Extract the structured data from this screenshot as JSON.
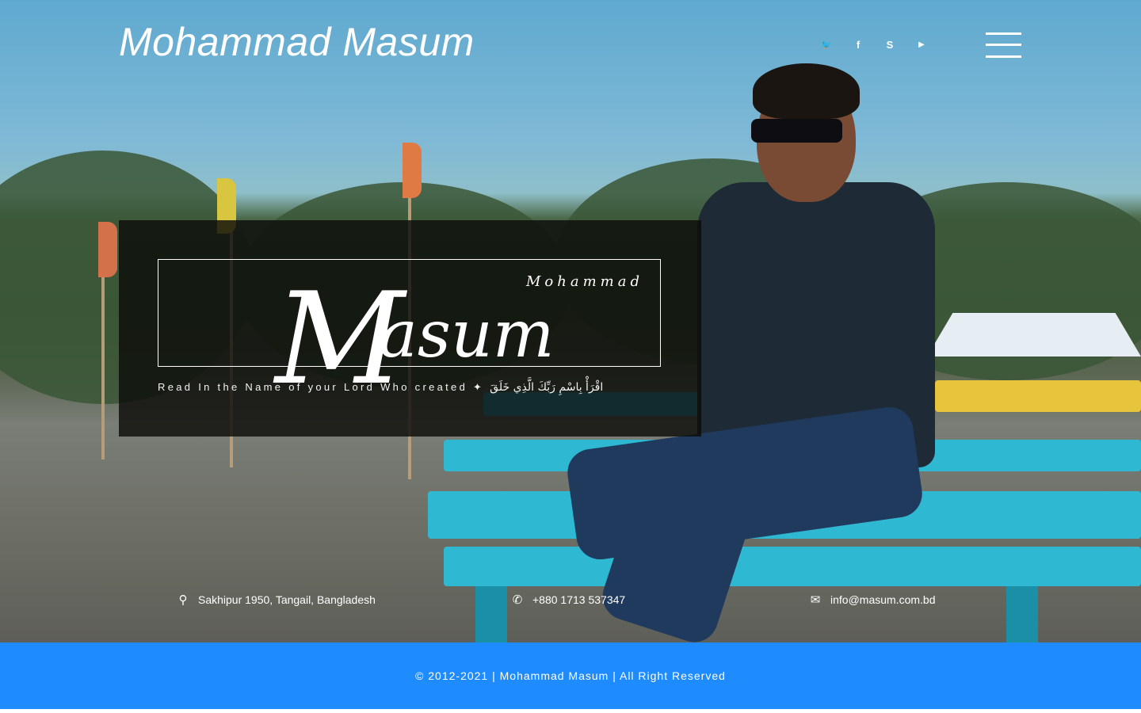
{
  "header": {
    "site_title": "Mohammad Masum",
    "social": [
      {
        "icon": "twitter-icon",
        "glyph": "🐦"
      },
      {
        "icon": "facebook-icon",
        "glyph": "f"
      },
      {
        "icon": "skype-icon",
        "glyph": "S"
      },
      {
        "icon": "youtube-icon",
        "glyph": "▶"
      }
    ]
  },
  "hero": {
    "logo_initial": "M",
    "logo_rest": "asum",
    "logo_first_name": "Mohammad",
    "tagline_en": "Read In the Name of your Lord Who created",
    "tagline_sep": "✦",
    "tagline_ar": "اقْرَأْ بِاسْمِ رَبِّكَ الَّذِي خَلَقَ"
  },
  "contacts": {
    "address": "Sakhipur 1950, Tangail, Bangladesh",
    "phone": "+880 1713 537347",
    "email": "info@masum.com.bd"
  },
  "footer": {
    "copyright": "© 2012-2021 | Mohammad Masum | All Right Reserved"
  },
  "colors": {
    "footer_bg": "#1e8bff",
    "overlay_bg": "rgba(12,12,10,0.82)"
  }
}
